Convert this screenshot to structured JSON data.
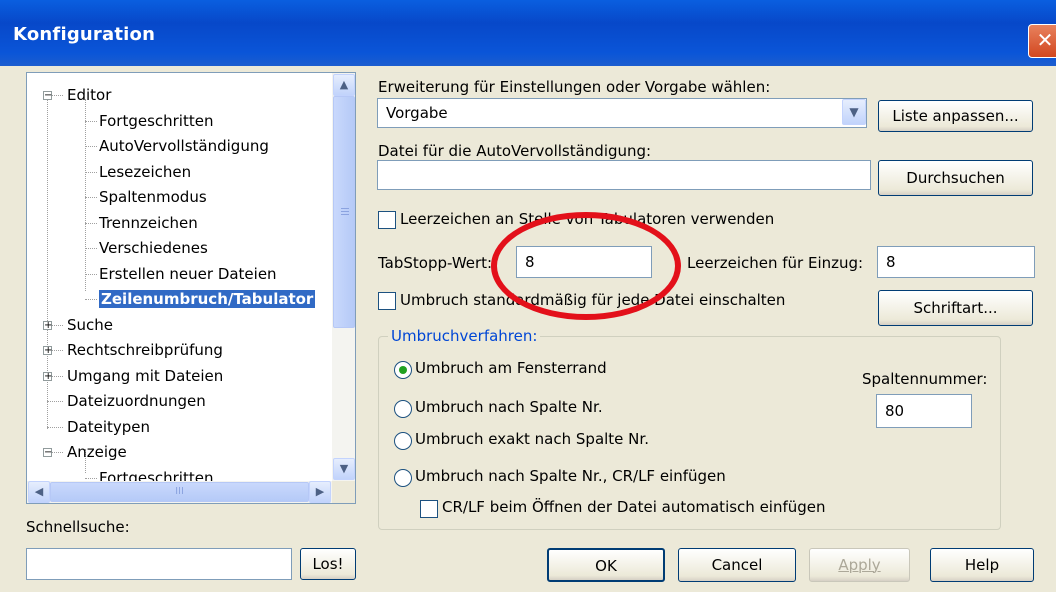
{
  "window": {
    "title": "Konfiguration",
    "close_icon": "close-icon",
    "accent": "#0a5fe0"
  },
  "tree": {
    "nodes": [
      {
        "label": "Editor",
        "expander": "−"
      },
      {
        "label": "Fortgeschritten"
      },
      {
        "label": "AutoVervollständigung"
      },
      {
        "label": "Lesezeichen"
      },
      {
        "label": "Spaltenmodus"
      },
      {
        "label": "Trennzeichen"
      },
      {
        "label": "Verschiedenes"
      },
      {
        "label": "Erstellen neuer Dateien"
      },
      {
        "label": "Zeilenumbruch/Tabulator",
        "selected": true
      },
      {
        "label": "Suche",
        "expander": "+"
      },
      {
        "label": "Rechtschreibprüfung",
        "expander": "+"
      },
      {
        "label": "Umgang mit Dateien",
        "expander": "+"
      },
      {
        "label": "Dateizuordnungen"
      },
      {
        "label": "Dateitypen"
      },
      {
        "label": "Anzeige",
        "expander": "−"
      },
      {
        "label": "Fortgeschritten"
      }
    ],
    "selection_color": "#316ac5"
  },
  "quicksearch": {
    "label": "Schnellsuche:",
    "value": "",
    "button": "Los!"
  },
  "settings": {
    "extension_label": "Erweiterung für Einstellungen oder Vorgabe wählen:",
    "extension_value": "Vorgabe",
    "customize_button": "Liste anpassen...",
    "autocomplete_label": "Datei für die AutoVervollständigung:",
    "autocomplete_value": "",
    "browse_button": "Durchsuchen",
    "use_spaces_label": "Leerzeichen an Stelle von Tabulatoren verwenden",
    "use_spaces_checked": false,
    "tabstop_label": "TabStopp-Wert:",
    "tabstop_value": "8",
    "indent_label": "Leerzeichen für Einzug:",
    "indent_value": "8",
    "wrap_default_label": "Umbruch standardmäßig für jede Datei einschalten",
    "wrap_default_checked": false,
    "font_button": "Schriftart..."
  },
  "wrap_method": {
    "group_label": "Umbruchverfahren:",
    "options": [
      {
        "label": "Umbruch am Fensterrand",
        "selected": true
      },
      {
        "label": "Umbruch nach Spalte Nr.",
        "selected": false
      },
      {
        "label": "Umbruch exakt nach Spalte Nr.",
        "selected": false
      },
      {
        "label": "Umbruch nach Spalte Nr., CR/LF einfügen",
        "selected": false
      }
    ],
    "column_label": "Spaltennummer:",
    "column_value": "80",
    "crlf_label": "CR/LF beim Öffnen der Datei automatisch einfügen",
    "crlf_checked": false
  },
  "footer": {
    "ok": "OK",
    "cancel": "Cancel",
    "apply": "Apply",
    "help": "Help"
  },
  "annotation": {
    "highlight_color": "#e3101a"
  }
}
